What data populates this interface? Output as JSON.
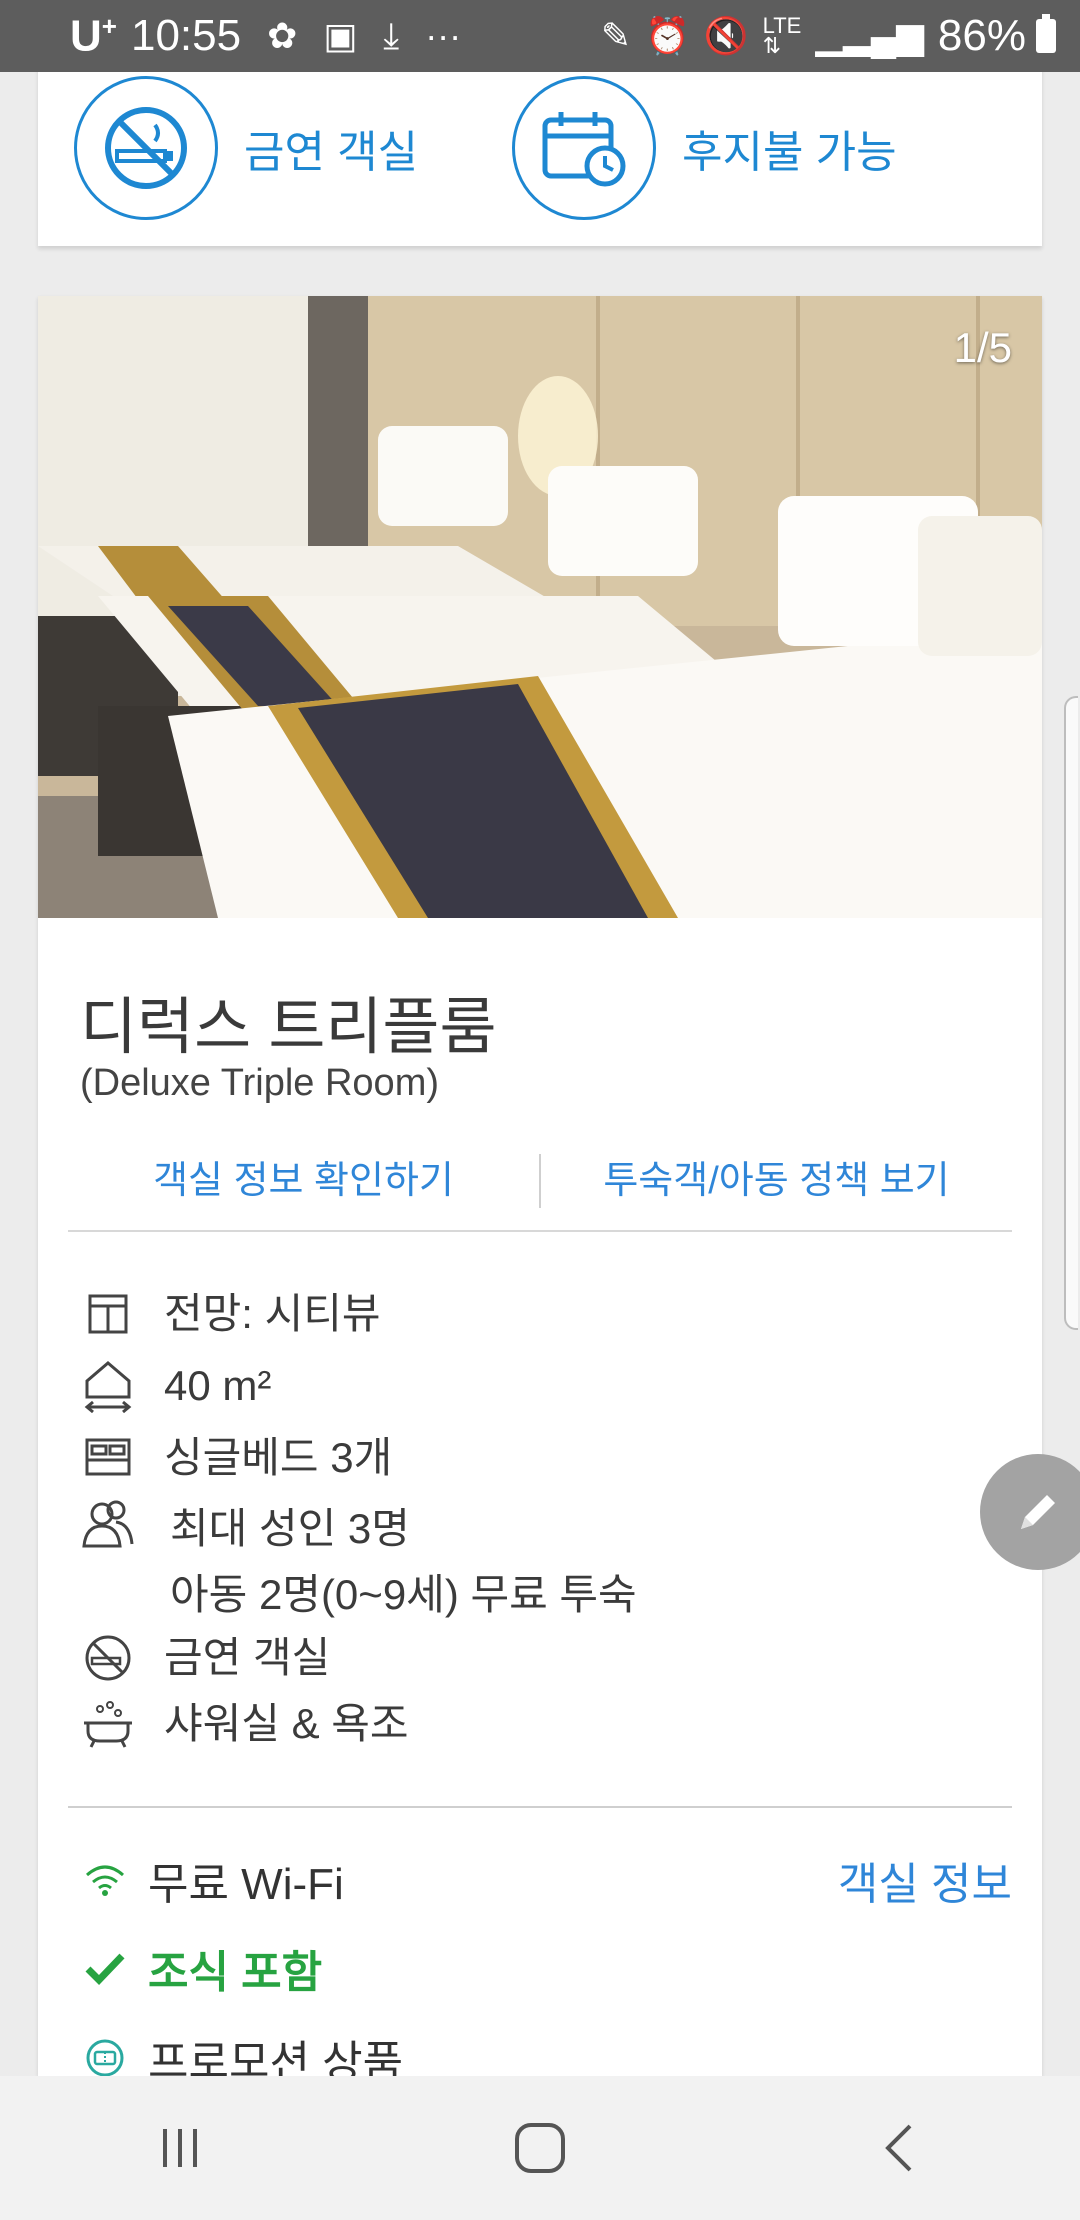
{
  "status_bar": {
    "carrier": "U",
    "carrier_plus": "+",
    "time": "10:55",
    "battery": "86%"
  },
  "features": [
    {
      "label": "금연 객실",
      "icon": "no-smoking-icon"
    },
    {
      "label": "후지불 가능",
      "icon": "calendar-clock-icon"
    }
  ],
  "room": {
    "photo_counter": "1/5",
    "title": "디럭스 트리플룸",
    "subtitle": "(Deluxe Triple Room)",
    "links": [
      "객실 정보 확인하기",
      "투숙객/아동 정책 보기"
    ],
    "details": {
      "view": "전망: 시티뷰",
      "size": "40 m²",
      "beds": "싱글베드 3개",
      "occupancy_line1": "최대 성인 3명",
      "occupancy_line2": "아동 2명(0~9세) 무료 투숙",
      "smoking": "금연 객실",
      "bath": "샤워실 & 욕조"
    },
    "amenities": {
      "wifi": "무료 Wi-Fi",
      "breakfast": "조식 포함",
      "promo": "프로모션 상품"
    },
    "room_info_link": "객실 정보"
  },
  "colors": {
    "accent_blue": "#1e88d2",
    "link_blue": "#2f86d8",
    "green": "#27a341"
  }
}
